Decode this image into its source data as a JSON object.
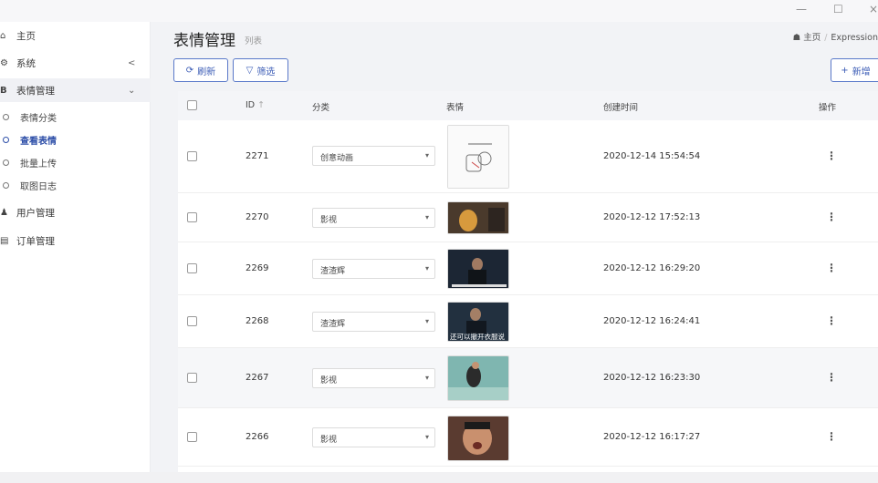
{
  "window": {
    "minimize": "—",
    "maximize": "☐",
    "close": "×"
  },
  "sidebar": {
    "items": [
      {
        "icon": "home-icon",
        "glyph": "⌂",
        "label": "主页"
      },
      {
        "icon": "gear-icon",
        "glyph": "⚙",
        "label": "系统",
        "arrow": "<"
      },
      {
        "icon": "b-icon",
        "glyph": "B",
        "label": "表情管理",
        "arrow": "⌄"
      }
    ],
    "sub_items": [
      {
        "label": "表情分类"
      },
      {
        "label": "查看表情"
      },
      {
        "label": "批量上传"
      },
      {
        "label": "取图日志"
      }
    ],
    "items2": [
      {
        "icon": "user-icon",
        "glyph": "♟",
        "label": "用户管理"
      },
      {
        "icon": "order-icon",
        "glyph": "▤",
        "label": "订单管理"
      }
    ]
  },
  "header": {
    "title": "表情管理",
    "subtitle": "列表",
    "breadcrumb_home": "主页",
    "breadcrumb_current": "Expression"
  },
  "toolbar": {
    "refresh_icon": "⟳",
    "refresh": "刷新",
    "filter_icon": "▽",
    "filter": "筛选",
    "add_icon": "+",
    "add": "新增"
  },
  "table": {
    "columns": [
      "ID",
      "分类",
      "表情",
      "创建时间",
      "操作"
    ],
    "sort_icon": "↑",
    "rows": [
      {
        "id": "2271",
        "category": "创意动画",
        "created": "2020-12-14 15:54:54",
        "thumb": "sketch"
      },
      {
        "id": "2270",
        "category": "影视",
        "created": "2020-12-12 17:52:13",
        "thumb": "warm"
      },
      {
        "id": "2269",
        "category": "渣渣辉",
        "created": "2020-12-12 16:29:20",
        "thumb": "dark"
      },
      {
        "id": "2268",
        "category": "渣渣辉",
        "created": "2020-12-12 16:24:41",
        "thumb": "dark2",
        "caption": "还可以撤开衣服说"
      },
      {
        "id": "2267",
        "category": "影视",
        "created": "2020-12-12 16:23:30",
        "thumb": "teal"
      },
      {
        "id": "2266",
        "category": "影视",
        "created": "2020-12-12 16:17:27",
        "thumb": "face"
      }
    ]
  },
  "colors": {
    "accent": "#3a5bb5",
    "border": "#5a79c9"
  }
}
